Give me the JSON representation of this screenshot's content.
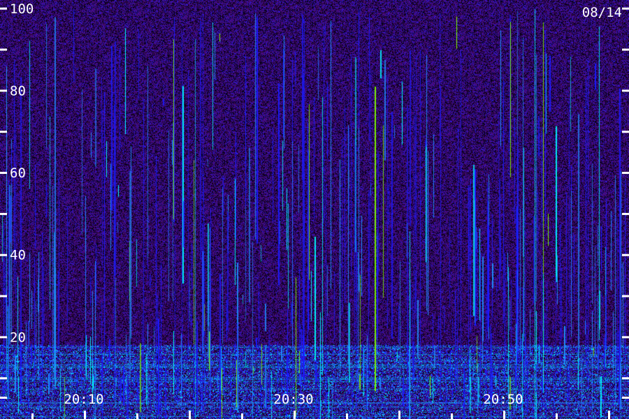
{
  "chart_data": {
    "type": "heatmap",
    "date": "08/14",
    "y_ticks": [
      10,
      20,
      30,
      40,
      50,
      60,
      70,
      80,
      90,
      100
    ],
    "y_tick_labels": [
      {
        "value": 20,
        "label": "20"
      },
      {
        "value": 40,
        "label": "40"
      },
      {
        "value": 60,
        "label": "60"
      },
      {
        "value": 80,
        "label": "80"
      },
      {
        "value": 100,
        "label": "100"
      }
    ],
    "ylim": [
      0,
      102
    ],
    "x_tick_labels": [
      "20:10",
      "20:30",
      "20:50"
    ],
    "xlim": [
      "20:02",
      "21:02"
    ],
    "colormap": [
      "#3a0a5e",
      "#1a1aff",
      "#1e90ff",
      "#00ffff",
      "#7fff00"
    ]
  }
}
